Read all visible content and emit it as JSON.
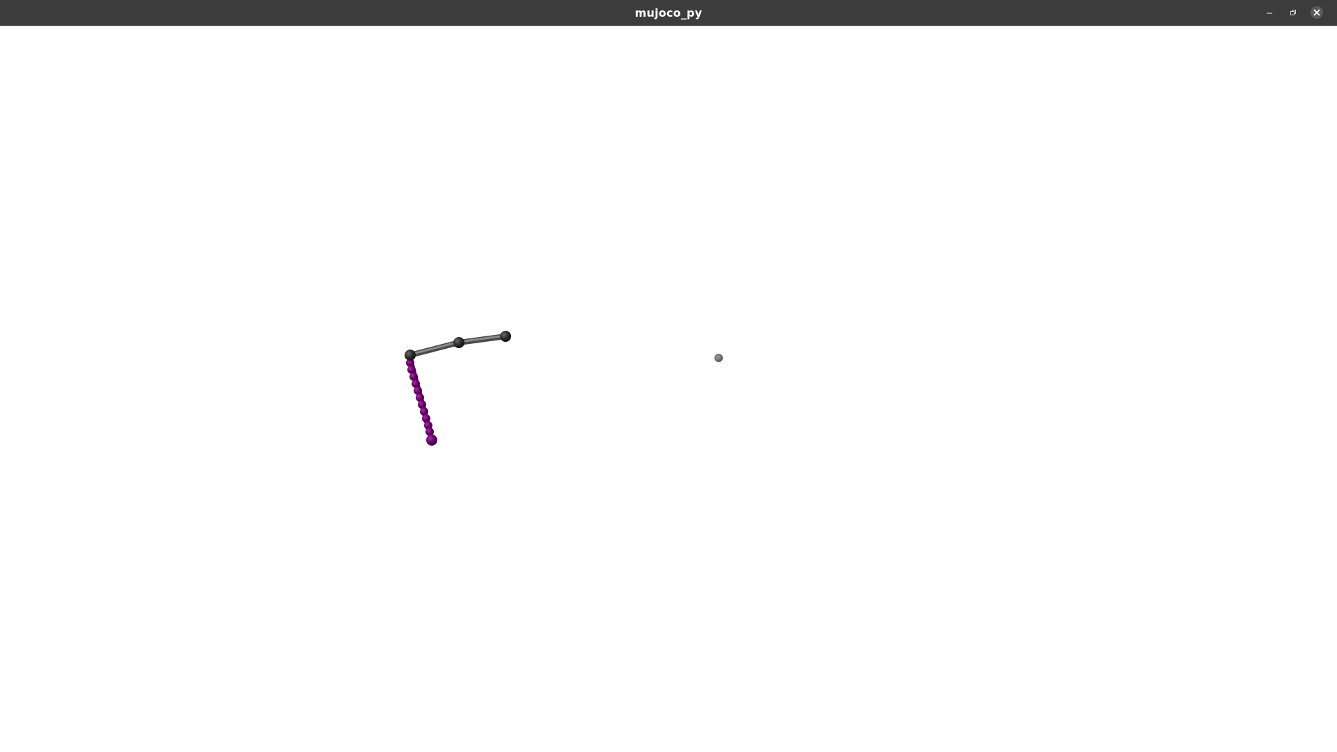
{
  "window": {
    "title": "mujoco_py",
    "controls": [
      "minimize-icon",
      "maximize-icon",
      "close-icon"
    ]
  },
  "scene": {
    "background_color": "#ffffff",
    "arm_color": "#6f6f6f",
    "joint_color": "#2a2a2a",
    "rope_color": "#6a006a",
    "target_color": "#6e6e6e"
  }
}
